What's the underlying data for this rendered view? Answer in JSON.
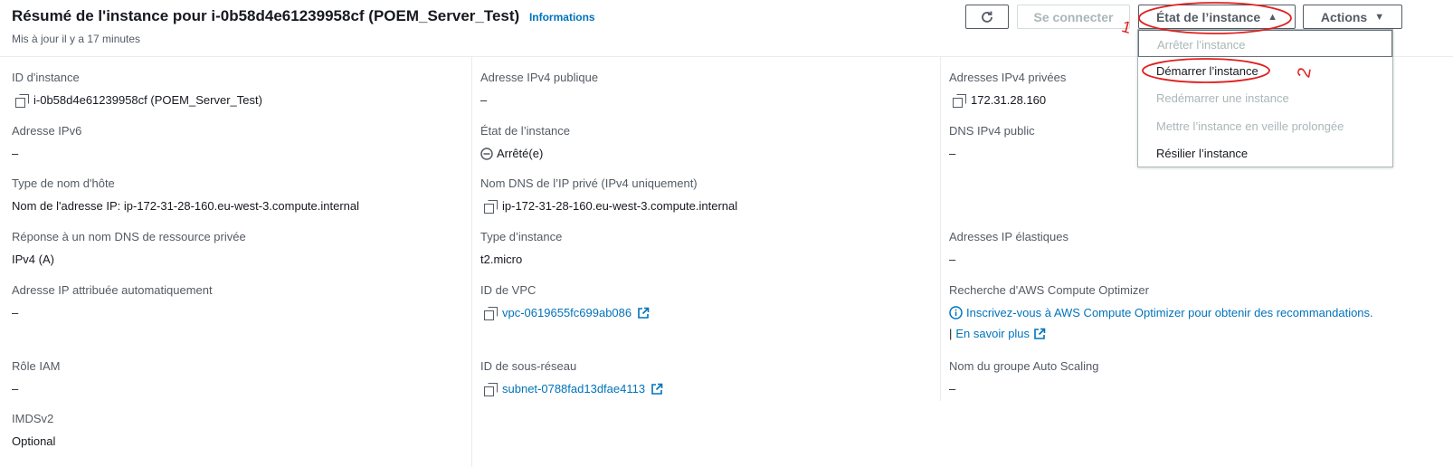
{
  "header": {
    "title": "Résumé de l'instance pour i-0b58d4e61239958cf (POEM_Server_Test)",
    "info_link": "Informations",
    "subtitle": "Mis à jour il y a 17 minutes"
  },
  "toolbar": {
    "refresh_icon": "refresh-icon",
    "connect_label": "Se connecter",
    "state_label": "État de l’instance",
    "actions_label": "Actions"
  },
  "state_menu": {
    "items": [
      {
        "label": "Arrêter l’instance",
        "enabled": false
      },
      {
        "label": "Démarrer l’instance",
        "enabled": true
      },
      {
        "label": "Redémarrer une instance",
        "enabled": false
      },
      {
        "label": "Mettre l’instance en veille prolongée",
        "enabled": false
      },
      {
        "label": "Résilier l’instance",
        "enabled": true
      }
    ]
  },
  "annotations": {
    "mark_1": "1",
    "mark_2": "2",
    "color": "#e02020"
  },
  "col1": {
    "instance_id": {
      "label": "ID d'instance",
      "value": "i-0b58d4e61239958cf (POEM_Server_Test)"
    },
    "ipv6": {
      "label": "Adresse IPv6",
      "value": "–"
    },
    "hostname_type": {
      "label": "Type de nom d'hôte",
      "value": "Nom de l'adresse IP: ip-172-31-28-160.eu-west-3.compute.internal"
    },
    "dns_response": {
      "label": "Réponse à un nom DNS de ressource privée",
      "value": "IPv4 (A)"
    },
    "auto_ip": {
      "label": "Adresse IP attribuée automatiquement",
      "value": "–"
    },
    "iam_role": {
      "label": "Rôle IAM",
      "value": "–"
    },
    "imdsv2": {
      "label": "IMDSv2",
      "value": "Optional"
    }
  },
  "col2": {
    "public_ipv4": {
      "label": "Adresse IPv4 publique",
      "value": "–"
    },
    "instance_state": {
      "label": "État de l’instance",
      "value": "Arrêté(e)"
    },
    "private_dns": {
      "label": "Nom DNS de l’IP privé (IPv4 uniquement)",
      "value": "ip-172-31-28-160.eu-west-3.compute.internal"
    },
    "instance_type": {
      "label": "Type d’instance",
      "value": "t2.micro"
    },
    "vpc_id": {
      "label": "ID de VPC",
      "value": "vpc-0619655fc699ab086"
    },
    "subnet_id": {
      "label": "ID de sous-réseau",
      "value": "subnet-0788fad13dfae4113"
    }
  },
  "col3": {
    "private_ipv4": {
      "label": "Adresses IPv4 privées",
      "value": "172.31.28.160"
    },
    "public_dns": {
      "label": "DNS IPv4 public",
      "value": "–"
    },
    "elastic_ips": {
      "label": "Adresses IP élastiques",
      "value": "–"
    },
    "optimizer": {
      "label": "Recherche d'AWS Compute Optimizer",
      "value": "Inscrivez-vous à AWS Compute Optimizer pour obtenir des recommandations.",
      "learn_more_sep": "|",
      "learn_more": "En savoir plus"
    },
    "asg_name": {
      "label": "Nom du groupe Auto Scaling",
      "value": "–"
    }
  },
  "colors": {
    "link": "#0073bb",
    "text": "#16191f",
    "muted": "#545b64",
    "disabled": "#aab7b8"
  }
}
